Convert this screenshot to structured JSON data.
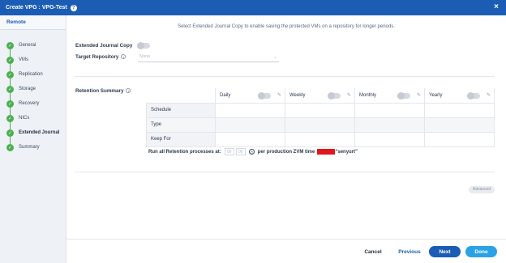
{
  "window": {
    "title": "Create VPG : VPG-Test",
    "help_glyph": "?",
    "close_glyph": "×"
  },
  "sidebar": {
    "section": "Remote",
    "steps": [
      {
        "label": "General"
      },
      {
        "label": "VMs"
      },
      {
        "label": "Replication"
      },
      {
        "label": "Storage"
      },
      {
        "label": "Recovery"
      },
      {
        "label": "NICs"
      },
      {
        "label": "Extended Journal"
      },
      {
        "label": "Summary"
      }
    ]
  },
  "main": {
    "hint": "Select Extended Journal Copy to enable saving the protected VMs on a repository for longer periods.",
    "extended_journal_copy_label": "Extended Journal Copy",
    "target_repository_label": "Target Repository",
    "target_repository_value": "None",
    "retention_summary_label": "Retention Summary",
    "columns": [
      "Daily",
      "Weekly",
      "Monthly",
      "Yearly"
    ],
    "rows": [
      "Schedule",
      "Type",
      "Keep For"
    ],
    "run_label": "Run all Retention processes at:",
    "run_hour": "00",
    "run_minute": "00",
    "run_suffix_pre": "per production ZVM time",
    "run_suffix_post": "“senyurt”",
    "advanced_label": "Advanced"
  },
  "footer": {
    "cancel": "Cancel",
    "previous": "Previous",
    "next": "Next",
    "done": "Done"
  },
  "colors": {
    "header": "#1b5cb5",
    "step_complete": "#4caf50",
    "next": "#1b5cb5",
    "done": "#29a3e6",
    "redaction": "#e3141b"
  },
  "icons": {
    "step": "check-icon",
    "info": "info-icon",
    "edit": "pencil-icon",
    "time": "clock-icon",
    "dropdown": "chevron-down-icon"
  }
}
